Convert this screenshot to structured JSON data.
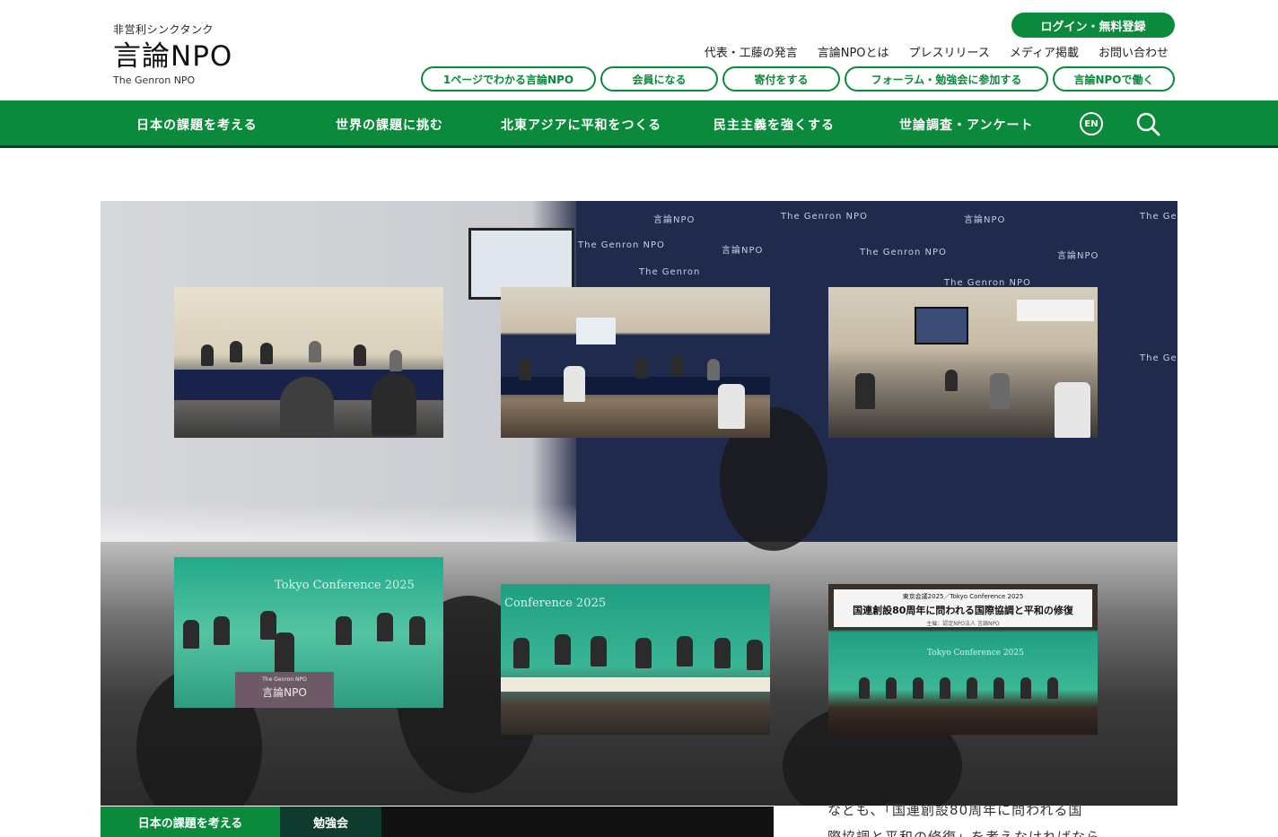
{
  "header": {
    "logo_tagline": "非営利シンクタンク",
    "logo_main": "言論NPO",
    "logo_sub": "The Genron NPO",
    "login_label": "ログイン・無料登録",
    "util_links": [
      "代表・工藤の発言",
      "言論NPOとは",
      "プレスリリース",
      "メディア掲載",
      "お問い合わせ"
    ],
    "pills": [
      "1ページでわかる言論NPO",
      "会員になる",
      "寄付をする",
      "フォーラム・勉強会に参加する",
      "言論NPOで働く"
    ]
  },
  "main_nav": {
    "items": [
      "日本の課題を考える",
      "世界の課題に挑む",
      "北東アジアに平和をつくる",
      "民主主義を強くする",
      "世論調査・アンケート"
    ],
    "en_label": "EN",
    "search_icon": "search-icon"
  },
  "hero": {
    "wall_texts": [
      "言論NPO",
      "The Genron NPO",
      "言論NPO",
      "The Ge",
      "The Genron NPO",
      "言論NPO",
      "The Genron NPO",
      "言論NPO",
      "The Genron",
      "The Genron NPO",
      "The Ge"
    ],
    "thumbs": [
      {
        "kind": "meeting-room"
      },
      {
        "kind": "conference-hall"
      },
      {
        "kind": "video-address"
      },
      {
        "kind": "stage-podium",
        "stage_text": "Tokyo Conference 2025",
        "podium_line1": "The Genron NPO",
        "podium_line2": "言論NPO"
      },
      {
        "kind": "stage-panel",
        "stage_text": "Conference 2025"
      },
      {
        "kind": "stage-banner",
        "banner_line1": "東京会議2025／Tokyo Conference 2025",
        "banner_line2": "国連創設80周年に問われる国際協調と平和の修復",
        "banner_line3": "主催：認定NPO法人 言論NPO",
        "stage_text": "Tokyo Conference 2025"
      }
    ]
  },
  "article_strip": {
    "category": "日本の課題を考える",
    "subcategory": "勉強会",
    "excerpt_line1": "なども、「国連創設80周年に問われる国",
    "excerpt_line2": "際協調と平和の修復」を考えなければなら"
  },
  "colors": {
    "brand_green": "#0b8a3b",
    "nav_border": "#0a3f2a",
    "subcategory_bg": "#0d3b2e"
  }
}
